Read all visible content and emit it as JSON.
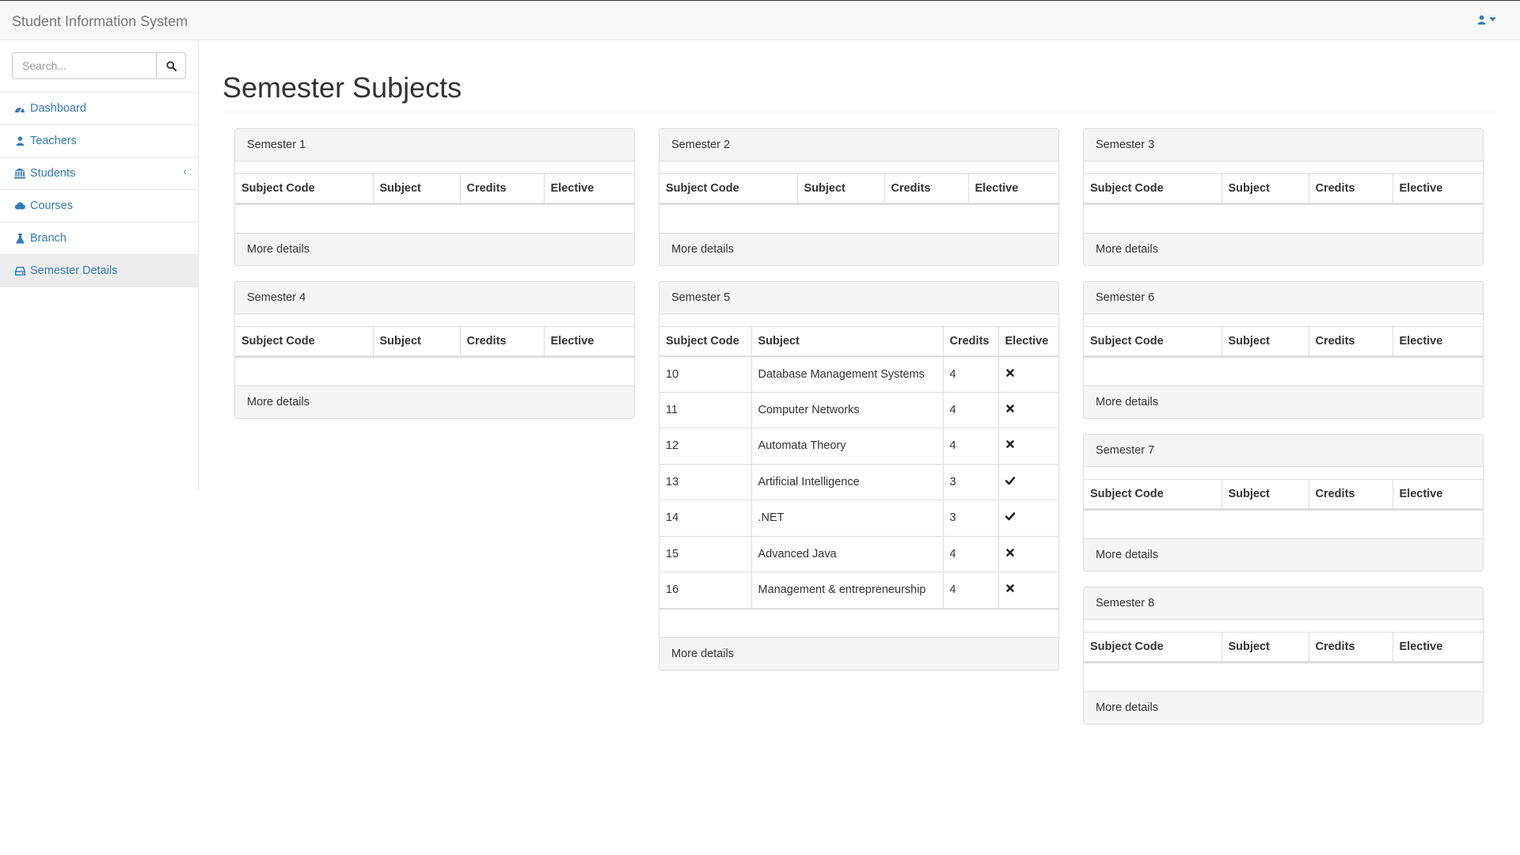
{
  "app": {
    "title": "Student Information System"
  },
  "user_menu": {
    "icon": "user-icon"
  },
  "search": {
    "placeholder": "Search...",
    "value": ""
  },
  "sidebar": {
    "items": [
      {
        "label": "Dashboard",
        "icon": "dashboard-icon"
      },
      {
        "label": "Teachers",
        "icon": "user-icon"
      },
      {
        "label": "Students",
        "icon": "bank-icon"
      },
      {
        "label": "Courses",
        "icon": "cloud-icon"
      },
      {
        "label": "Branch",
        "icon": "flask-icon"
      },
      {
        "label": "Semester Details",
        "icon": "hdd-icon",
        "active": true
      }
    ],
    "collapse_indicator": "‹"
  },
  "page": {
    "title": "Semester Subjects"
  },
  "table_headers": [
    "Subject Code",
    "Subject",
    "Credits",
    "Elective"
  ],
  "footer_label": "More details",
  "semesters": [
    {
      "title": "Semester 1",
      "rows": []
    },
    {
      "title": "Semester 2",
      "rows": []
    },
    {
      "title": "Semester 3",
      "rows": []
    },
    {
      "title": "Semester 4",
      "rows": []
    },
    {
      "title": "Semester 5",
      "rows": [
        {
          "code": "10",
          "subject": "Database Management Systems",
          "credits": "4",
          "elective": false
        },
        {
          "code": "11",
          "subject": "Computer Networks",
          "credits": "4",
          "elective": false
        },
        {
          "code": "12",
          "subject": "Automata Theory",
          "credits": "4",
          "elective": false
        },
        {
          "code": "13",
          "subject": "Artificial Intelligence",
          "credits": "3",
          "elective": true
        },
        {
          "code": "14",
          "subject": ".NET",
          "credits": "3",
          "elective": true
        },
        {
          "code": "15",
          "subject": "Advanced Java",
          "credits": "4",
          "elective": false
        },
        {
          "code": "16",
          "subject": "Management & entrepreneurship",
          "credits": "4",
          "elective": false
        }
      ]
    },
    {
      "title": "Semester 6",
      "rows": []
    },
    {
      "title": "Semester 7",
      "rows": []
    },
    {
      "title": "Semester 8",
      "rows": []
    }
  ],
  "colors": {
    "link": "#337ab7",
    "panel_heading_bg": "#f5f5f5",
    "border": "#dddddd",
    "navbar_bg": "#f8f8f8"
  }
}
